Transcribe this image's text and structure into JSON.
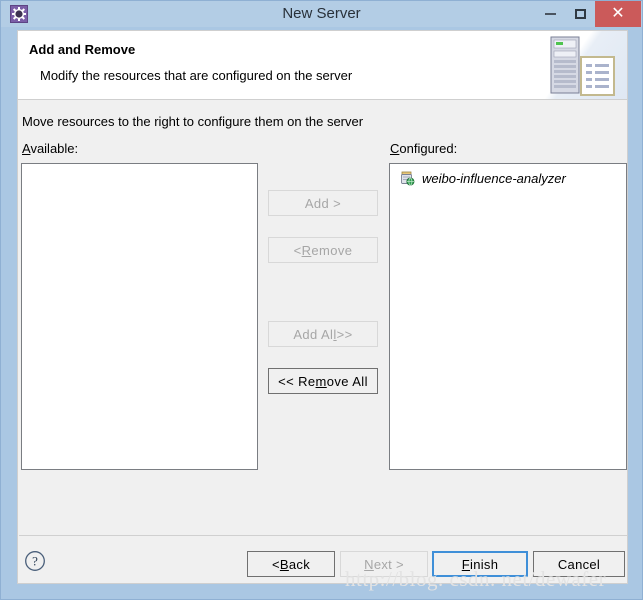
{
  "window": {
    "title": "New Server",
    "icon": "gear-icon",
    "controls": {
      "minimize": "minimize-icon",
      "maximize": "maximize-icon",
      "close": "✕"
    }
  },
  "banner": {
    "title": "Add and Remove",
    "description": "Modify the resources that are configured on the server",
    "art": "server-and-document-icon"
  },
  "body": {
    "hint": "Move resources to the right to configure them on the server",
    "available": {
      "label_mnemonic": "A",
      "label_rest": "vailable:",
      "items": []
    },
    "configured": {
      "label_mnemonic": "C",
      "label_rest": "onfigured:",
      "items": [
        {
          "name": "weibo-influence-analyzer",
          "icon": "module-globe-icon"
        }
      ]
    },
    "transfer_buttons": [
      {
        "id": "add",
        "pre": "Add ",
        "mnemonic": "",
        "post": "",
        "full": "Add >",
        "enabled": false
      },
      {
        "id": "remove",
        "pre": "< ",
        "mnemonic": "R",
        "post": "emove",
        "full": "< Remove",
        "enabled": false
      },
      {
        "id": "add-all",
        "pre": "Add Al",
        "mnemonic": "l",
        "post": " >>",
        "full": "Add All >>",
        "enabled": false
      },
      {
        "id": "remove-all",
        "pre": "<< Re",
        "mnemonic": "m",
        "post": "ove All",
        "full": "<< Remove All",
        "enabled": true
      }
    ]
  },
  "footer": {
    "help": "?",
    "buttons": [
      {
        "id": "back",
        "pre": "< ",
        "mnemonic": "B",
        "post": "ack",
        "state": "enabled"
      },
      {
        "id": "next",
        "pre": "",
        "mnemonic": "N",
        "post": "ext >",
        "state": "disabled"
      },
      {
        "id": "finish",
        "pre": "",
        "mnemonic": "F",
        "post": "inish",
        "state": "default"
      },
      {
        "id": "cancel",
        "pre": "Cancel",
        "mnemonic": "",
        "post": "",
        "state": "enabled"
      }
    ]
  },
  "watermark": "http://blog. csdn. net/dewafer",
  "colors": {
    "titlebar": "#b3cde5",
    "close_button": "#cb5a5a",
    "window_border": "#8fb0d3",
    "body_bg": "#f0f0f0",
    "default_button_border": "#3f8fd8",
    "icon_purple": "#7b5ea7"
  }
}
